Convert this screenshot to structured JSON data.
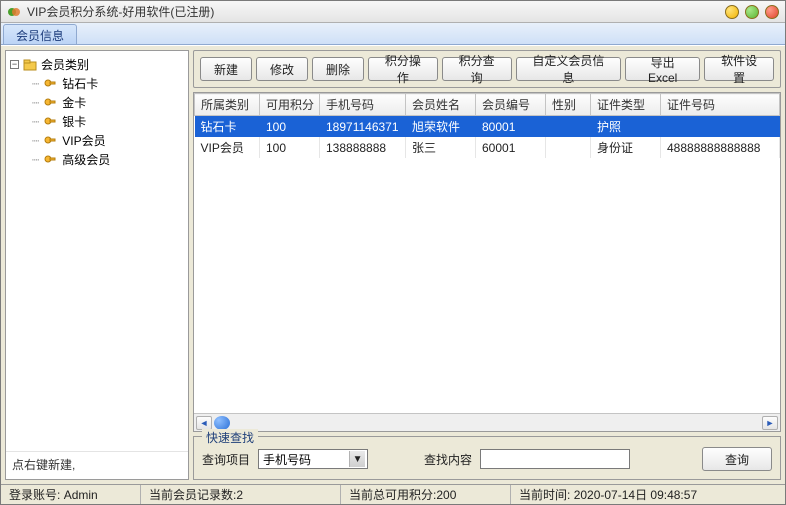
{
  "window": {
    "title": "VIP会员积分系统-好用软件(已注册)"
  },
  "tabs": [
    {
      "label": "会员信息"
    }
  ],
  "tree": {
    "root_label": "会员类别",
    "items": [
      {
        "label": "钻石卡"
      },
      {
        "label": "金卡"
      },
      {
        "label": "银卡"
      },
      {
        "label": "VIP会员"
      },
      {
        "label": "高级会员"
      }
    ]
  },
  "sidebar": {
    "hint": "点右键新建,"
  },
  "toolbar": {
    "new": "新建",
    "edit": "修改",
    "delete": "删除",
    "points_op": "积分操作",
    "points_query": "积分查询",
    "custom_info": "自定义会员信息",
    "export_excel": "导出Excel",
    "settings": "软件设置"
  },
  "grid": {
    "headers": [
      "所属类别",
      "可用积分",
      "手机号码",
      "会员姓名",
      "会员编号",
      "性别",
      "证件类型",
      "证件号码"
    ],
    "rows": [
      {
        "selected": true,
        "cells": [
          "钻石卡",
          "100",
          "18971146371",
          "旭荣软件",
          "80001",
          "",
          "护照",
          ""
        ]
      },
      {
        "selected": false,
        "cells": [
          "VIP会员",
          "100",
          "138888888",
          "张三",
          "60001",
          "",
          "身份证",
          "48888888888888"
        ]
      }
    ]
  },
  "search": {
    "legend": "快速查找",
    "field_label": "查询项目",
    "field_value": "手机号码",
    "content_label": "查找内容",
    "content_value": "",
    "button": "查询"
  },
  "status": {
    "account_label": "登录账号:",
    "account_value": "Admin",
    "count_label": "当前会员记录数:",
    "count_value": "2",
    "points_label": "当前总可用积分:",
    "points_value": "200",
    "time_label": "当前时间:",
    "time_value": "2020-07-14日 09:48:57"
  }
}
